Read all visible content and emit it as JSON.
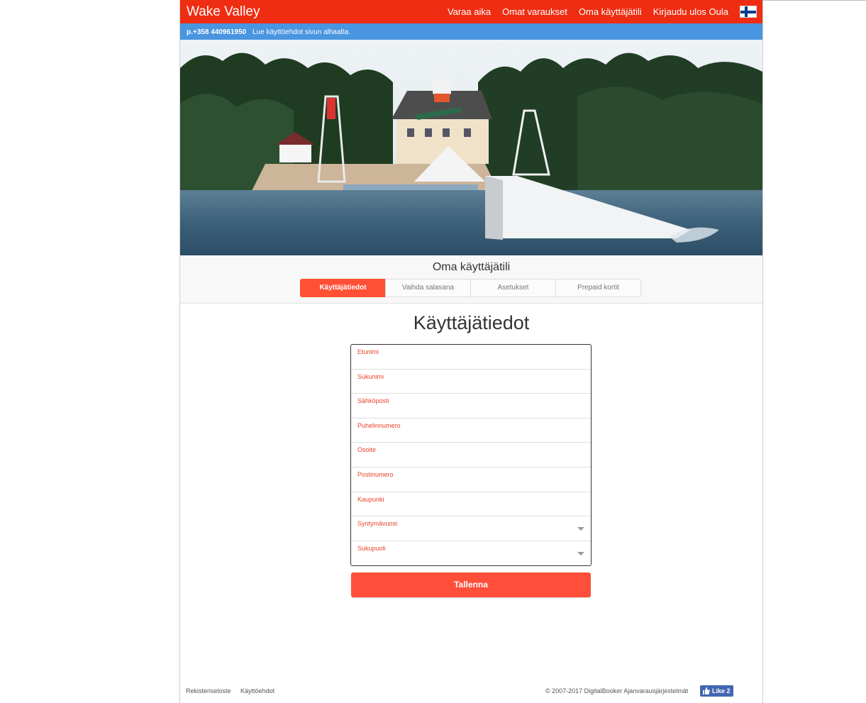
{
  "nav": {
    "brand": "Wake Valley",
    "links": [
      "Varaa aika",
      "Omat varaukset",
      "Oma käyttäjätili",
      "Kirjaudu ulos Oula"
    ],
    "flag_icon": "finland-flag-icon"
  },
  "infobar": {
    "phone": "p.+358 440961950",
    "text": "Lue käyttöehdot sivun alhaalta."
  },
  "account": {
    "title": "Oma käyttäjätili",
    "tabs": [
      "Käyttäjätiedot",
      "Vaihda salasana",
      "Asetukset",
      "Prepaid kortit"
    ],
    "active_tab": "Käyttäjätiedot"
  },
  "form": {
    "heading": "Käyttäjätiedot",
    "fields": [
      {
        "label": "Etunimi",
        "value": ""
      },
      {
        "label": "Sukunimi",
        "value": ""
      },
      {
        "label": "Sähköposti",
        "value": ""
      },
      {
        "label": "Puhelinnumero",
        "value": ""
      },
      {
        "label": "Osoite",
        "value": ""
      },
      {
        "label": "Postinumero",
        "value": ""
      },
      {
        "label": "Kaupunki",
        "value": ""
      },
      {
        "label": "Syntymävuosi",
        "value": "",
        "type": "select"
      },
      {
        "label": "Sukupuoli",
        "value": "",
        "type": "select"
      }
    ],
    "save_label": "Tallenna"
  },
  "footer": {
    "links": [
      "Rekisteriseloste",
      "Käyttöehdot"
    ],
    "copyright": "© 2007-2017 DigitalBooker Ajanvarausjärjestelmät",
    "like_label": "Like 2"
  },
  "colors": {
    "brand_red": "#ee2d12",
    "info_blue": "#4a95e0",
    "accent": "#ff4f3a"
  }
}
